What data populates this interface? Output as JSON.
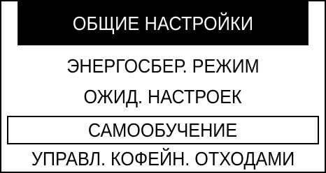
{
  "header": {
    "title": "ОБЩИЕ НАСТРОЙКИ"
  },
  "menu": {
    "items": [
      {
        "label": "ЭНЕРГОСБЕР. РЕЖИМ",
        "selected": false
      },
      {
        "label": "ОЖИД. НАСТРОЕК",
        "selected": false
      },
      {
        "label": "САМООБУЧЕНИЕ",
        "selected": true
      },
      {
        "label": "УПРАВЛ. КОФЕЙН. ОТХОДАМИ",
        "selected": false
      }
    ]
  },
  "colors": {
    "background": "#ffffff",
    "foreground": "#000000"
  }
}
